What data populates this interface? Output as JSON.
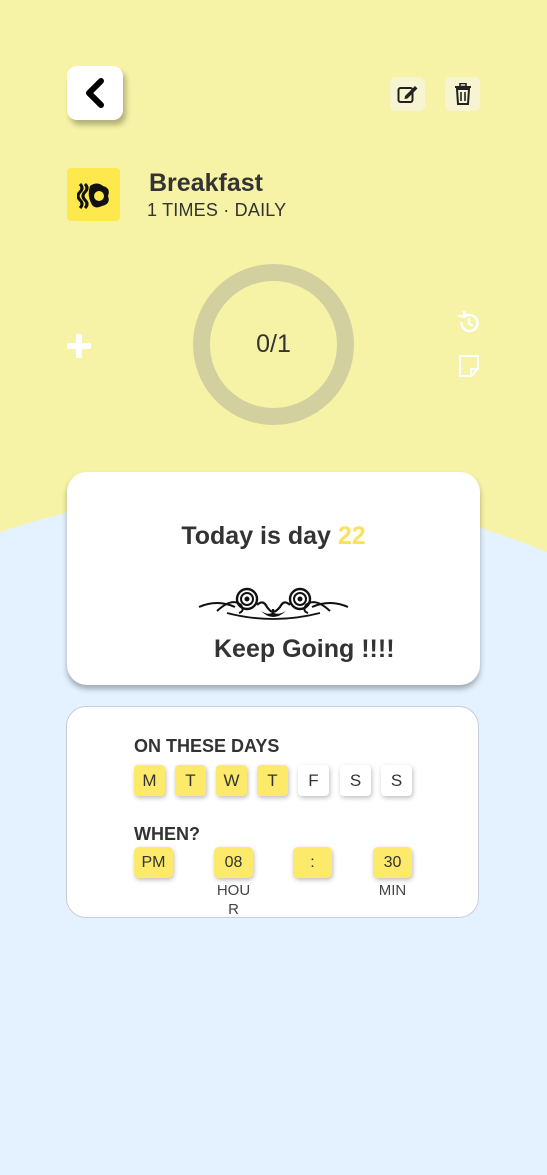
{
  "colors": {
    "top_background": "#f6f3a6",
    "page_background": "#e4f2ff",
    "accent_yellow": "#fde96a",
    "ring_color": "#d3d09f",
    "day_number_color": "#fde15c"
  },
  "header": {
    "back_icon": "chevron-left-icon",
    "edit_icon": "edit-icon",
    "delete_icon": "trash-icon"
  },
  "habit": {
    "icon": "bacon-egg-icon",
    "title": "Breakfast",
    "subtitle": "1 TIMES · DAILY"
  },
  "progress": {
    "text": "0/1",
    "completed": 0,
    "target": 1,
    "plus_icon": "plus-icon",
    "reset_icon": "history-icon",
    "note_icon": "note-icon"
  },
  "streak_card": {
    "prefix": "Today is day ",
    "day_number": "22",
    "ornament_icon": "flourish-ornament-icon",
    "motivation": "Keep Going !!!!"
  },
  "schedule": {
    "days_label": "ON THESE DAYS",
    "days": [
      {
        "label": "M",
        "active": true
      },
      {
        "label": "T",
        "active": true
      },
      {
        "label": "W",
        "active": true
      },
      {
        "label": "T",
        "active": true
      },
      {
        "label": "F",
        "active": false
      },
      {
        "label": "S",
        "active": false
      },
      {
        "label": "S",
        "active": false
      }
    ],
    "when_label": "WHEN?",
    "time": {
      "period": "PM",
      "hour": "08",
      "separator": ":",
      "minute": "30",
      "hour_caption_1": "HOU",
      "hour_caption_2": "R",
      "minute_caption": "MIN"
    }
  }
}
